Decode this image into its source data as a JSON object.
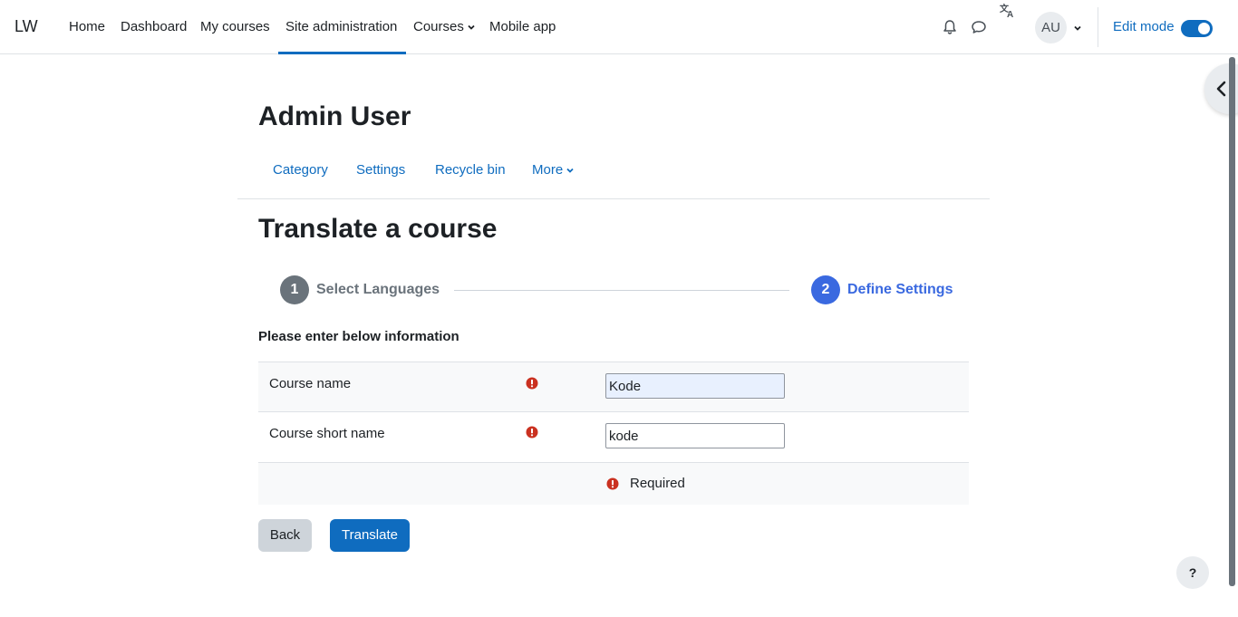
{
  "navbar": {
    "brand": "LW",
    "items": [
      {
        "label": "Home"
      },
      {
        "label": "Dashboard"
      },
      {
        "label": "My courses"
      },
      {
        "label": "Site administration",
        "active": true
      },
      {
        "label": "Courses",
        "has_dropdown": true
      },
      {
        "label": "Mobile app"
      }
    ],
    "icons": [
      "bell-icon",
      "chat-icon",
      "translate-icon",
      "chevron-down-icon"
    ],
    "avatar_initials": "AU",
    "edit_mode_label": "Edit mode",
    "edit_mode_on": true
  },
  "page_header": {
    "title": "Admin User",
    "secondary_nav": [
      "Category",
      "Settings",
      "Recycle bin",
      "More"
    ]
  },
  "main": {
    "heading": "Translate a course",
    "steps": [
      {
        "number": "1",
        "label": "Select Languages",
        "state": "inactive"
      },
      {
        "number": "2",
        "label": "Define Settings",
        "state": "active"
      }
    ],
    "form_intro": "Please enter below information",
    "fields": [
      {
        "label": "Course name",
        "value": "Kode",
        "required": true
      },
      {
        "label": "Course short name",
        "value": "kode",
        "required": true
      }
    ],
    "required_note": "Required",
    "buttons": {
      "back": "Back",
      "translate": "Translate"
    }
  },
  "help_label": "?",
  "colors": {
    "primary": "#0f6cbf",
    "step_active": "#3a69e0",
    "step_inactive": "#6a737b",
    "required_icon": "#ca3120",
    "back_button": "#ced4da"
  }
}
